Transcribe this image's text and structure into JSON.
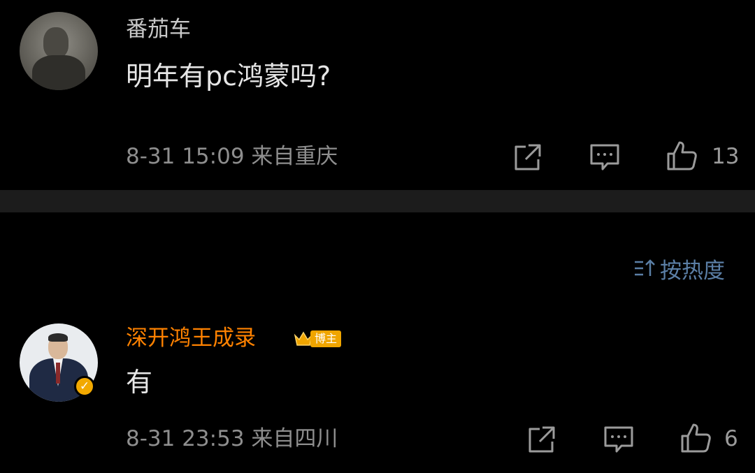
{
  "comments": [
    {
      "author": "番茄车",
      "text": "明年有pc鸿蒙吗?",
      "meta": "8-31 15:09  来自重庆",
      "likes": "13"
    },
    {
      "author": "深开鸿王成录",
      "host_badge": "博主",
      "text": "有",
      "meta": "8-31 23:53  来自四川",
      "likes": "6"
    }
  ],
  "sort": {
    "label": "按热度"
  },
  "colors": {
    "background": "#000000",
    "author_highlight": "#ff8200",
    "sort_link": "#5b7fa6",
    "divider": "#1c1c1c"
  },
  "icons": [
    "share-icon",
    "comment-icon",
    "like-icon",
    "sort-icon",
    "verified-icon",
    "crown-icon"
  ]
}
